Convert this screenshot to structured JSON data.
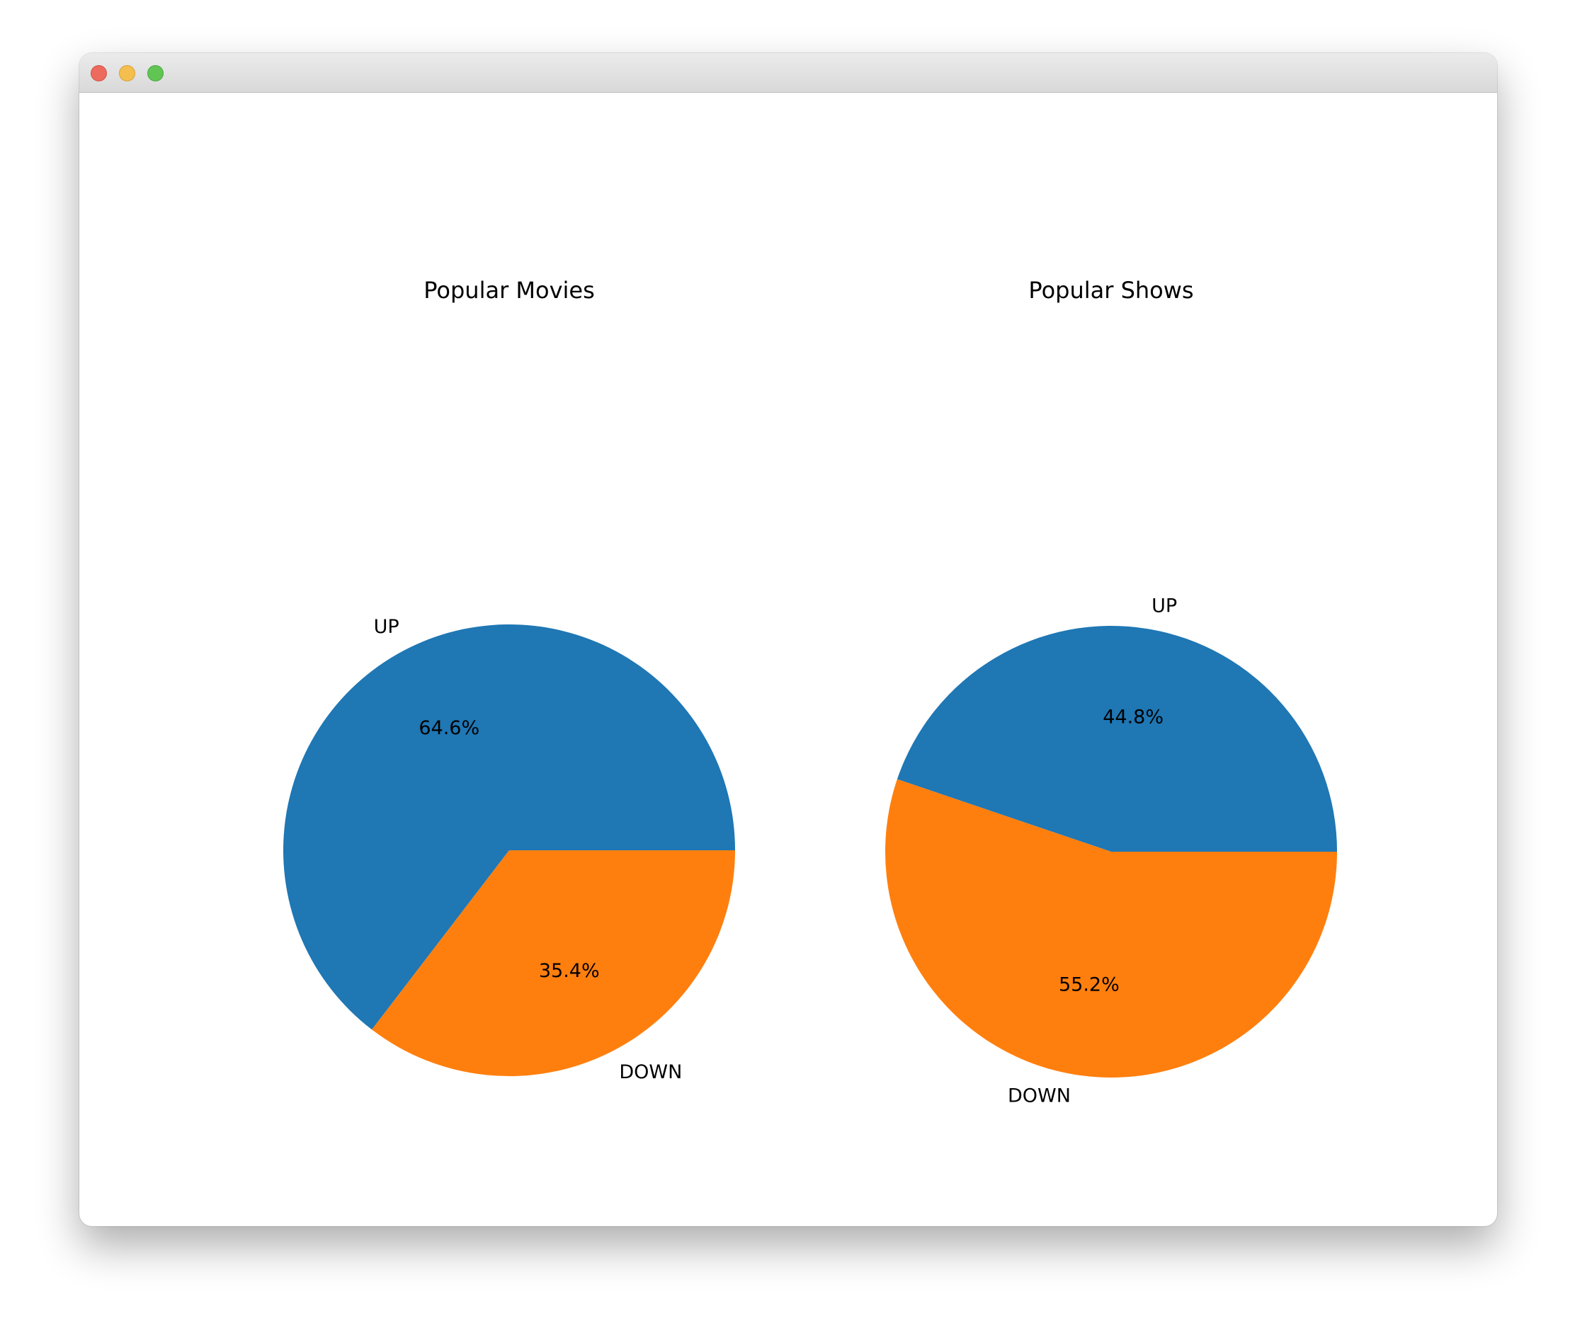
{
  "window": {
    "buttons": [
      "close",
      "minimize",
      "maximize"
    ]
  },
  "chart_data": [
    {
      "type": "pie",
      "title": "Popular Movies",
      "labels": [
        "UP",
        "DOWN"
      ],
      "values": [
        64.6,
        35.4
      ],
      "value_labels": [
        "64.6%",
        "35.4%"
      ],
      "colors": [
        "#1f77b4",
        "#ff7f0e"
      ],
      "start_angle_deg": 0,
      "direction": "counterclockwise"
    },
    {
      "type": "pie",
      "title": "Popular Shows",
      "labels": [
        "UP",
        "DOWN"
      ],
      "values": [
        44.8,
        55.2
      ],
      "value_labels": [
        "44.8%",
        "55.2%"
      ],
      "colors": [
        "#1f77b4",
        "#ff7f0e"
      ],
      "start_angle_deg": 0,
      "direction": "counterclockwise"
    }
  ]
}
